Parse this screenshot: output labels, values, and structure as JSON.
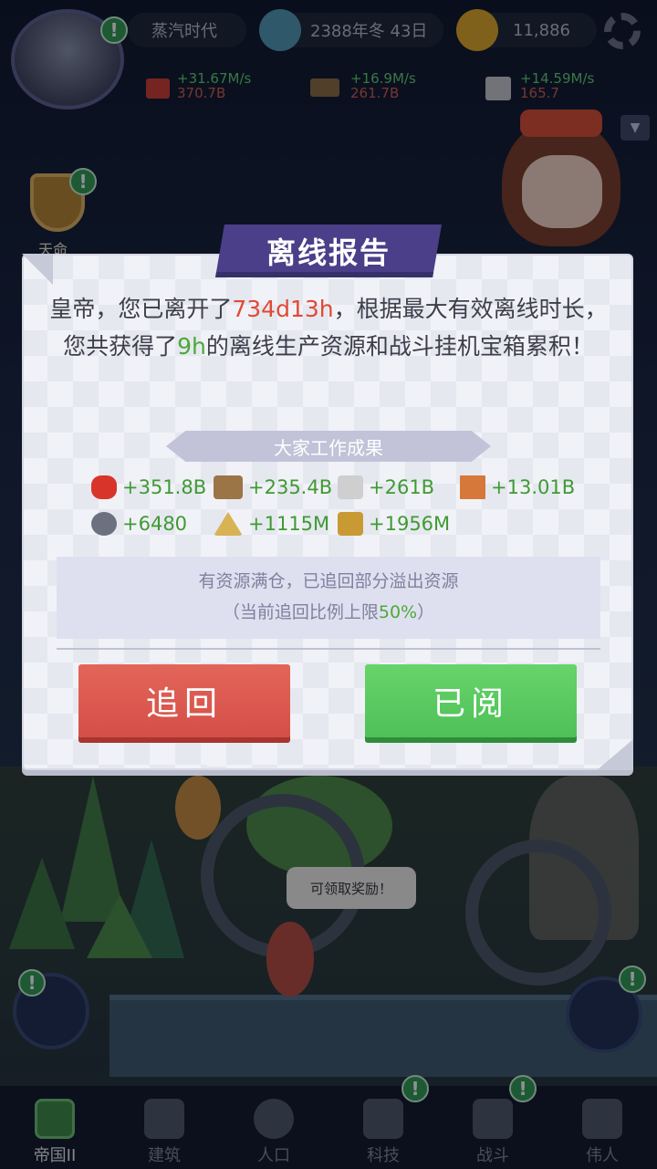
{
  "hud": {
    "era": "蒸汽时代",
    "date": "2388年冬 43日",
    "gold": "11,886",
    "resources": [
      {
        "rate": "+31.67M/s",
        "total": "370.7B",
        "icon": "red-ore-icon",
        "color": "#d03a2a"
      },
      {
        "rate": "+16.9M/s",
        "total": "261.7B",
        "icon": "wood-icon",
        "color": "#8a6a3a"
      },
      {
        "rate": "+14.59M/s",
        "total": "165.7",
        "icon": "stone-icon",
        "color": "#c9c9c9"
      }
    ]
  },
  "side": {
    "badge_label": "天命"
  },
  "dialog": {
    "title": "离线报告",
    "message_1": "皇帝，您已离开了",
    "message_time": "734d13h",
    "message_2": "，根据最大有效离线时长，您共获得了",
    "message_hours": "9h",
    "message_3": "的离线生产资源和战斗挂机宝箱累积！",
    "work_title": "大家工作成果",
    "results": [
      {
        "icon": "apple-icon",
        "value": "+351.8B",
        "color": "#d8342a"
      },
      {
        "icon": "wood-log-icon",
        "value": "+235.4B",
        "color": "#9b7546"
      },
      {
        "icon": "stone-block-icon",
        "value": "+261B",
        "color": "#cfcfcf"
      },
      {
        "icon": "brick-icon",
        "value": "+13.01B",
        "color": "#d5783a"
      },
      {
        "icon": "gear-icon",
        "value": "+6480",
        "color": "#6c7180"
      },
      {
        "icon": "sand-pile-icon",
        "value": "+1115M",
        "color": "#d8b356"
      },
      {
        "icon": "gold-cube-icon",
        "value": "+1956M",
        "color": "#c99a33"
      }
    ],
    "info_line1": "有资源满仓，已追回部分溢出资源",
    "info_line2_pre": "（当前追回比例上限",
    "info_pct": "50%",
    "info_line2_post": "）",
    "btn_recall": "追回",
    "btn_read": "已阅"
  },
  "scene": {
    "speech": "可领取奖励！"
  },
  "nav": [
    {
      "label": "帝国II",
      "icon": "castle-icon"
    },
    {
      "label": "建筑",
      "icon": "house-icon"
    },
    {
      "label": "人口",
      "icon": "person-icon"
    },
    {
      "label": "科技",
      "icon": "book-icon"
    },
    {
      "label": "战斗",
      "icon": "swords-icon"
    },
    {
      "label": "伟人",
      "icon": "statue-icon"
    }
  ]
}
